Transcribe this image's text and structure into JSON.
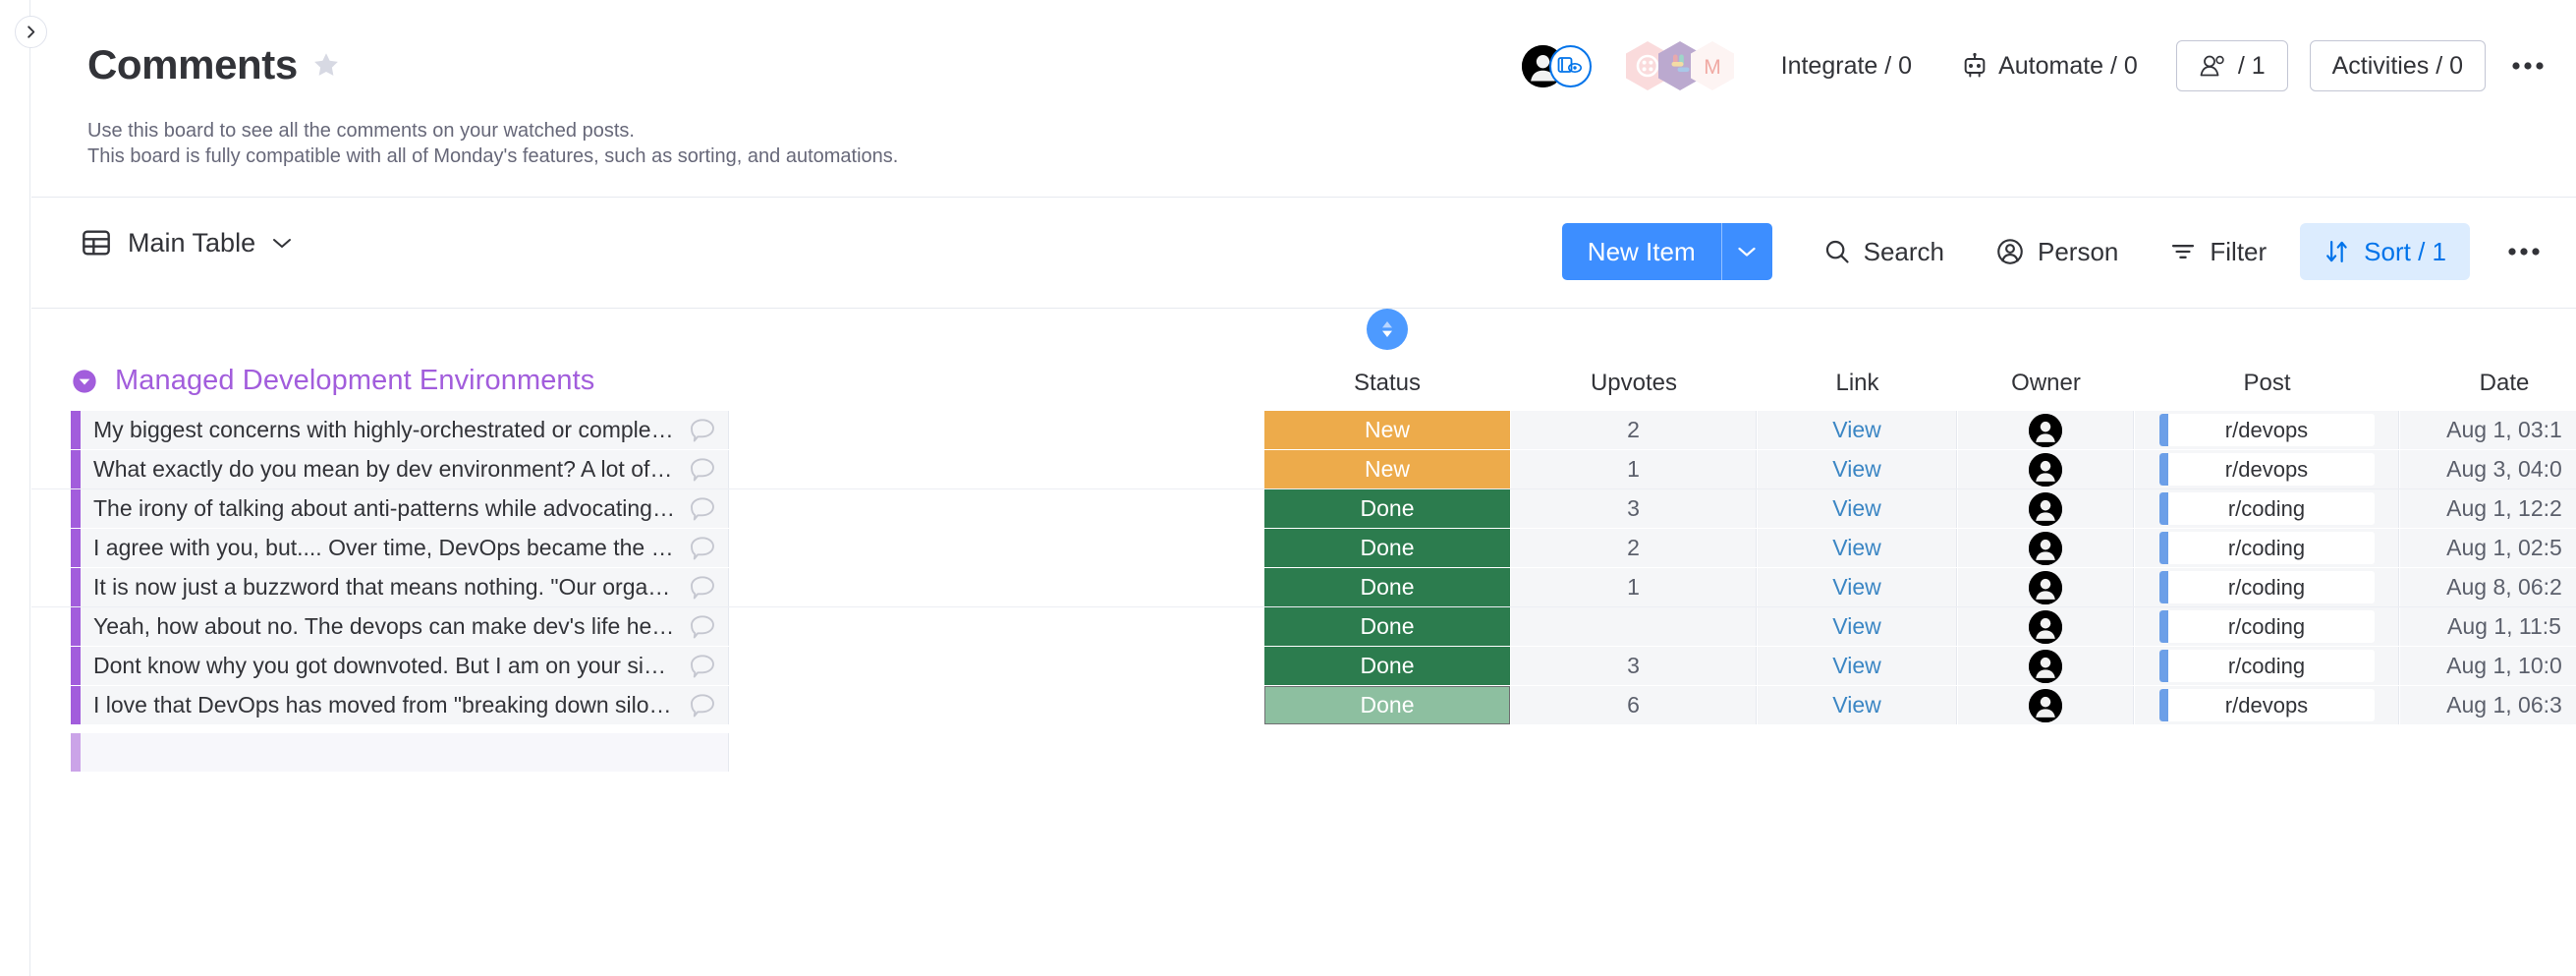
{
  "app": {
    "accent_blue": "#0073ea",
    "group_purple": "#a25ddc",
    "status_new": "#edab4b",
    "status_done": "#2c7c4e",
    "status_done_hover": "#8dbfa0"
  },
  "left_rail": {
    "expand_label": "expand-sidebar"
  },
  "header": {
    "title": "Comments",
    "favorite_icon": "star-icon",
    "description_line1": "Use this board to see all the comments on your watched posts.",
    "description_line2": "This board is fully compatible with all of Monday's features, such as sorting, and automations.",
    "avatar_icon": "person-avatar",
    "share_icon": "board-share-icon",
    "integrations": [
      {
        "name": "monday-app-icon",
        "color": "#f5c9cb"
      },
      {
        "name": "slack-icon",
        "color": "#b8a5cf"
      },
      {
        "name": "gmail-icon",
        "color": "#f3d6d4"
      }
    ],
    "integrate_label": "Integrate / 0",
    "automate_label": "Automate / 0",
    "automate_icon": "robot-icon",
    "members_label": "/ 1",
    "members_icon": "people-icon",
    "activities_label": "Activities / 0",
    "more_label": "more-options"
  },
  "toolbar": {
    "view_icon": "table-icon",
    "view_label": "Main Table",
    "view_caret": "chevron-down-icon",
    "new_item_label": "New Item",
    "new_item_caret": "chevron-down-icon",
    "search_label": "Search",
    "search_icon": "search-icon",
    "person_label": "Person",
    "person_icon": "person-circle-icon",
    "filter_label": "Filter",
    "filter_icon": "filter-icon",
    "sort_label": "Sort / 1",
    "sort_icon": "sort-arrows-icon",
    "more_label": "more-options"
  },
  "board": {
    "group_name": "Managed Development Environments",
    "group_collapse_icon": "chevron-down-circle-icon",
    "columns": [
      {
        "key": "name",
        "label": ""
      },
      {
        "key": "status",
        "label": "Status",
        "sorted": true
      },
      {
        "key": "upvotes",
        "label": "Upvotes"
      },
      {
        "key": "link",
        "label": "Link"
      },
      {
        "key": "owner",
        "label": "Owner"
      },
      {
        "key": "post",
        "label": "Post"
      },
      {
        "key": "date",
        "label": "Date"
      }
    ],
    "rows": [
      {
        "name": "My biggest concerns with highly-orchestrated or complex development environments: * They ofte…",
        "status": "New",
        "status_kind": "new",
        "upvotes": "2",
        "link": "View",
        "owner_icon": "person-avatar",
        "post": "r/devops",
        "date": "Aug 1, 03:1"
      },
      {
        "name": "What exactly do you mean by dev environment? A lot of the projects I roll come with a vagrant scr…",
        "status": "New",
        "status_kind": "new",
        "upvotes": "1",
        "link": "View",
        "owner_icon": "person-avatar",
        "post": "r/devops",
        "date": "Aug 3, 04:0"
      },
      {
        "name": "The irony of talking about anti-patterns while advocating for a \"DevOps\" team",
        "status": "Done",
        "status_kind": "done",
        "upvotes": "3",
        "link": "View",
        "owner_icon": "person-avatar",
        "post": "r/coding",
        "date": "Aug 1, 12:2"
      },
      {
        "name": "I agree with you, but.... Over time, DevOps became the term for an Ops team that codes scripts, a…",
        "status": "Done",
        "status_kind": "done",
        "upvotes": "2",
        "link": "View",
        "owner_icon": "person-avatar",
        "post": "r/coding",
        "date": "Aug 1, 02:5"
      },
      {
        "name": "It is now just a buzzword that means nothing. \"Our organization is going DevOps\" while they have…",
        "status": "Done",
        "status_kind": "done",
        "upvotes": "1",
        "link": "View",
        "owner_icon": "person-avatar",
        "post": "r/coding",
        "date": "Aug 8, 06:2"
      },
      {
        "name": "Yeah, how about no. The devops can make dev's life hell by fixing dependencies from 10 year ago…",
        "status": "Done",
        "status_kind": "done",
        "upvotes": "",
        "link": "View",
        "owner_icon": "person-avatar",
        "post": "r/coding",
        "date": "Aug 1, 11:5"
      },
      {
        "name": "Dont know why you got downvoted. But I am on your side. Devops should be Dev create their own…",
        "status": "Done",
        "status_kind": "done",
        "upvotes": "3",
        "link": "View",
        "owner_icon": "person-avatar",
        "post": "r/coding",
        "date": "Aug 1, 10:0"
      },
      {
        "name": "I love that DevOps has moved from \"breaking down silos and having devs work closely with ops\" t…",
        "status": "Done",
        "status_kind": "done-hover",
        "upvotes": "6",
        "link": "View",
        "owner_icon": "person-avatar",
        "post": "r/devops",
        "date": "Aug 1, 06:3"
      }
    ]
  }
}
